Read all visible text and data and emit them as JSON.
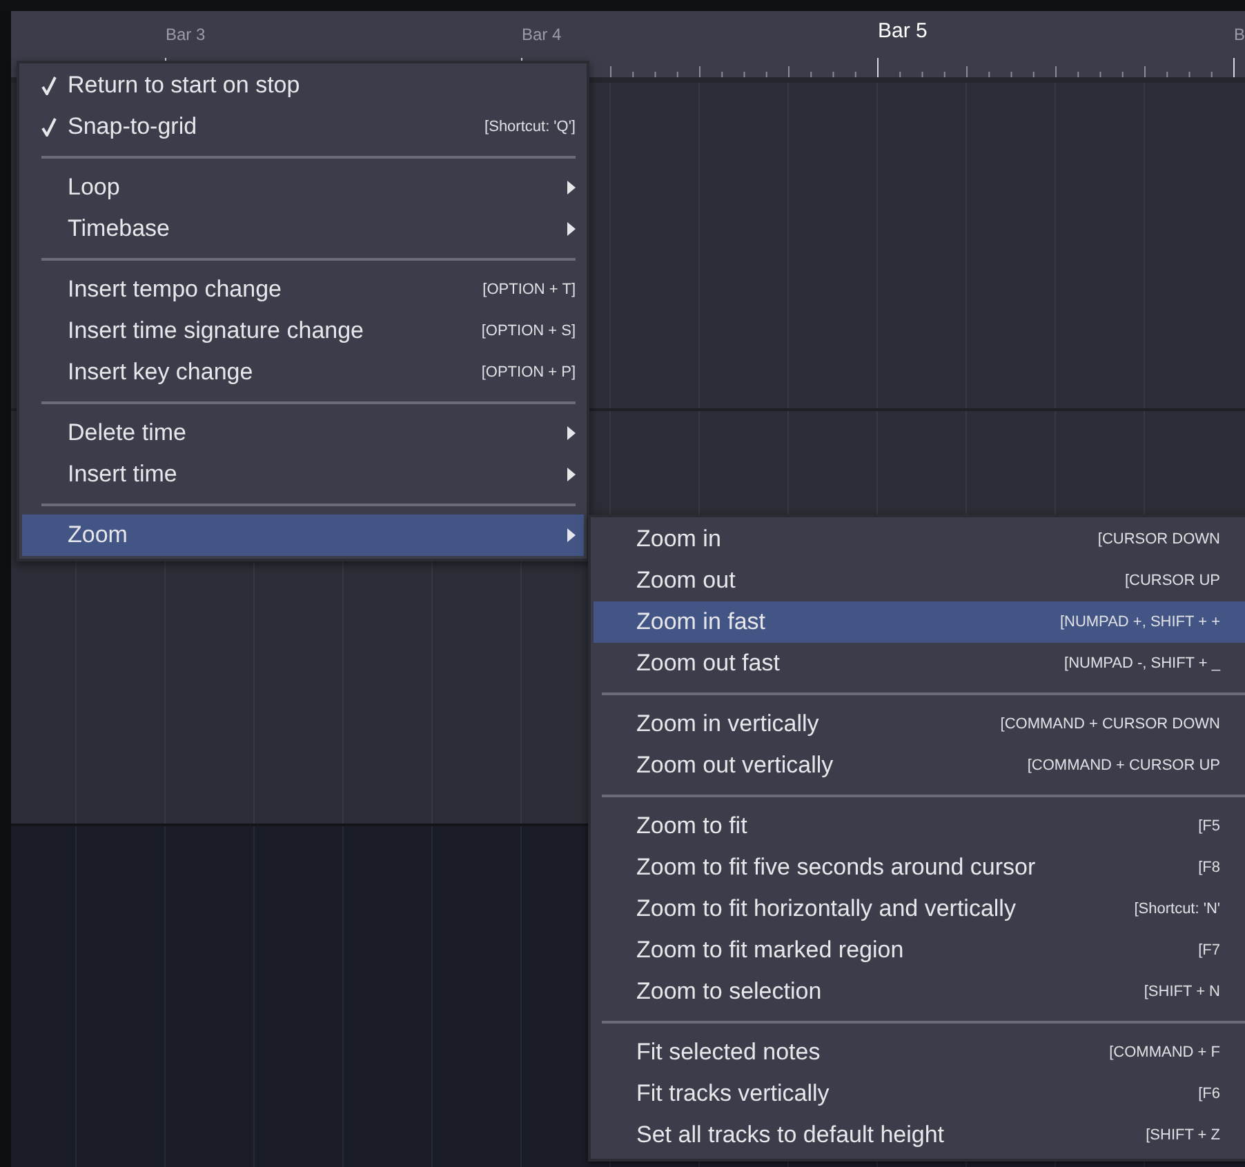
{
  "ruler": {
    "bars": [
      {
        "label": "Bar 3",
        "current": false
      },
      {
        "label": "Bar 4",
        "current": false
      },
      {
        "label": "Bar 5",
        "current": true
      },
      {
        "label": "B",
        "current": false
      }
    ]
  },
  "menu": {
    "items": [
      {
        "kind": "item",
        "label": "Return to start on stop",
        "checked": true,
        "submenu": false,
        "selected": false
      },
      {
        "kind": "item",
        "label": "Snap-to-grid",
        "checked": true,
        "submenu": false,
        "selected": false,
        "shortcut": "[Shortcut: 'Q']"
      },
      {
        "kind": "separator"
      },
      {
        "kind": "item",
        "label": "Loop",
        "checked": false,
        "submenu": true,
        "selected": false
      },
      {
        "kind": "item",
        "label": "Timebase",
        "checked": false,
        "submenu": true,
        "selected": false
      },
      {
        "kind": "separator"
      },
      {
        "kind": "item",
        "label": "Insert tempo change",
        "checked": false,
        "submenu": false,
        "selected": false,
        "shortcut": "[OPTION + T]"
      },
      {
        "kind": "item",
        "label": "Insert time signature change",
        "checked": false,
        "submenu": false,
        "selected": false,
        "shortcut": "[OPTION + S]"
      },
      {
        "kind": "item",
        "label": "Insert key change",
        "checked": false,
        "submenu": false,
        "selected": false,
        "shortcut": "[OPTION + P]"
      },
      {
        "kind": "separator"
      },
      {
        "kind": "item",
        "label": "Delete time",
        "checked": false,
        "submenu": true,
        "selected": false
      },
      {
        "kind": "item",
        "label": "Insert time",
        "checked": false,
        "submenu": true,
        "selected": false
      },
      {
        "kind": "separator"
      },
      {
        "kind": "item",
        "label": "Zoom",
        "checked": false,
        "submenu": true,
        "selected": true
      }
    ]
  },
  "submenu": {
    "items": [
      {
        "kind": "item",
        "label": "Zoom in",
        "selected": false,
        "shortcut": "[CURSOR DOWN"
      },
      {
        "kind": "item",
        "label": "Zoom out",
        "selected": false,
        "shortcut": "[CURSOR UP"
      },
      {
        "kind": "item",
        "label": "Zoom in fast",
        "selected": true,
        "shortcut": "[NUMPAD +, SHIFT + +"
      },
      {
        "kind": "item",
        "label": "Zoom out fast",
        "selected": false,
        "shortcut": "[NUMPAD -, SHIFT + _"
      },
      {
        "kind": "separator"
      },
      {
        "kind": "item",
        "label": "Zoom in vertically",
        "selected": false,
        "shortcut": "[COMMAND + CURSOR DOWN"
      },
      {
        "kind": "item",
        "label": "Zoom out vertically",
        "selected": false,
        "shortcut": "[COMMAND + CURSOR UP"
      },
      {
        "kind": "separator"
      },
      {
        "kind": "item",
        "label": "Zoom to fit",
        "selected": false,
        "shortcut": "[F5"
      },
      {
        "kind": "item",
        "label": "Zoom to fit five seconds around cursor",
        "selected": false,
        "shortcut": "[F8"
      },
      {
        "kind": "item",
        "label": "Zoom to fit horizontally and vertically",
        "selected": false,
        "shortcut": "[Shortcut: 'N'"
      },
      {
        "kind": "item",
        "label": "Zoom to fit marked region",
        "selected": false,
        "shortcut": "[F7"
      },
      {
        "kind": "item",
        "label": "Zoom to selection",
        "selected": false,
        "shortcut": "[SHIFT + N"
      },
      {
        "kind": "separator"
      },
      {
        "kind": "item",
        "label": "Fit selected notes",
        "selected": false,
        "shortcut": "[COMMAND + F"
      },
      {
        "kind": "item",
        "label": "Fit tracks vertically",
        "selected": false,
        "shortcut": "[F6"
      },
      {
        "kind": "item",
        "label": "Set all tracks to default height",
        "selected": false,
        "shortcut": "[SHIFT + Z"
      }
    ]
  }
}
